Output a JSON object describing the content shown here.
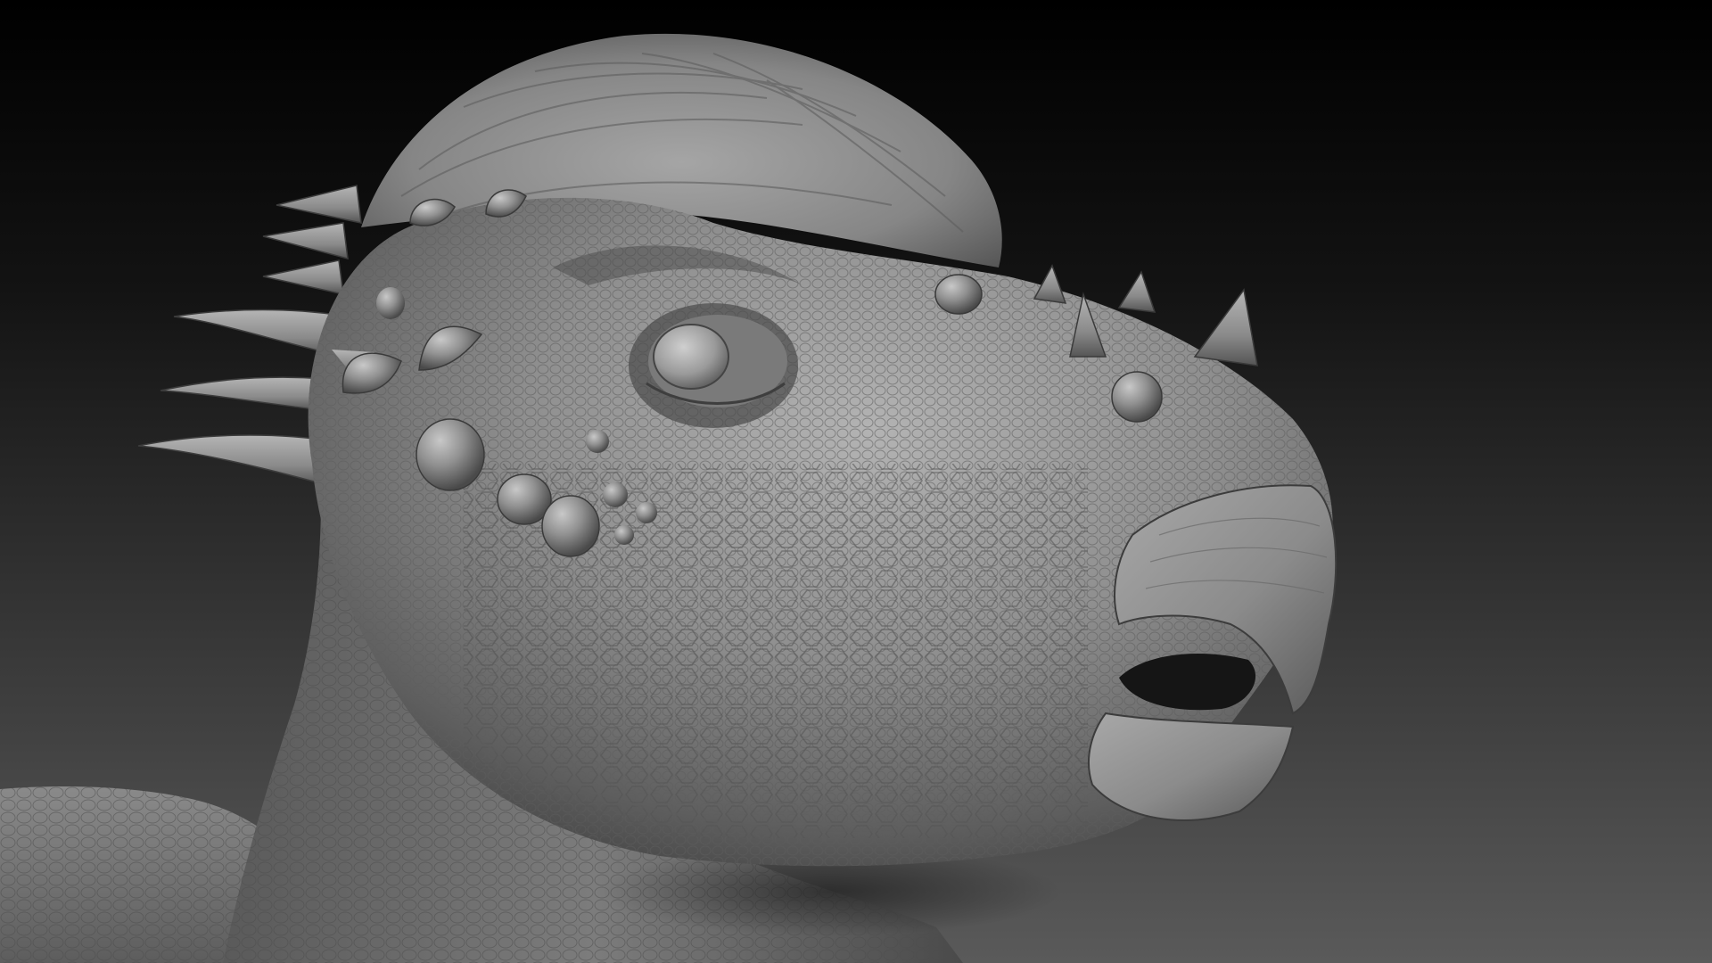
{
  "scene": {
    "subject": "pachycephalosaur-head-sculpt",
    "background_gradient": [
      "#000000",
      "#141414",
      "#3a3a3a",
      "#5a5a5a"
    ],
    "clay_colors": {
      "highlight": "#b9b9b9",
      "mid": "#8a8a8a",
      "shadow": "#3e3e3e",
      "deep": "#222222"
    }
  }
}
